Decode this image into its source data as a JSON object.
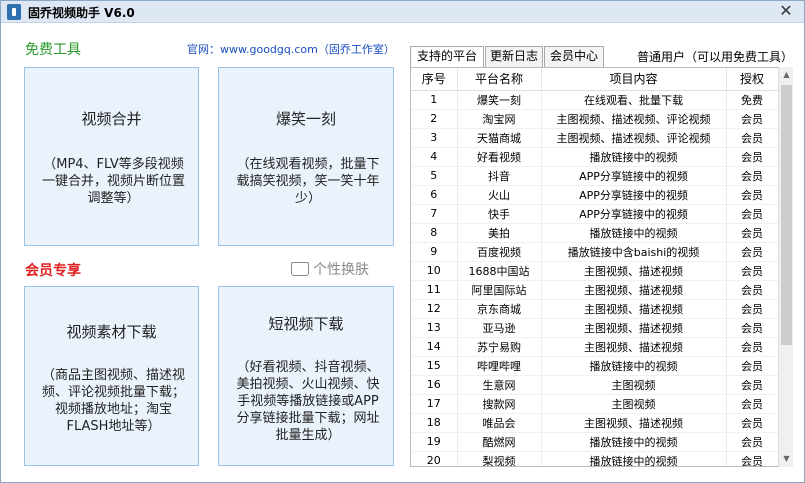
{
  "window": {
    "title": "固乔视频助手 V6.0",
    "close_glyph": "✕"
  },
  "free_section": {
    "label": "免费工具",
    "official_site": "官网：www.goodgq.com（固乔工作室）"
  },
  "member_section": {
    "label": "会员专享",
    "skin_label": "个性换肤"
  },
  "cards": [
    {
      "title": "视频合并",
      "desc": "（MP4、FLV等多段视频一键合并，视频片断位置调整等）"
    },
    {
      "title": "爆笑一刻",
      "desc": "（在线观看视频，批量下载搞笑视频，笑一笑十年少）"
    },
    {
      "title": "视频素材下载",
      "desc": "（商品主图视频、描述视频、评论视频批量下载；视频播放地址；淘宝FLASH地址等）"
    },
    {
      "title": "短视频下载",
      "desc": "（好看视频、抖音视频、美拍视频、火山视频、快手视频等播放链接或APP分享链接批量下载；网址批量生成）"
    }
  ],
  "tabs": [
    "支持的平台",
    "更新日志",
    "会员中心"
  ],
  "user_type": "普通用户（可以用免费工具）",
  "table": {
    "columns": [
      "序号",
      "平台名称",
      "项目内容",
      "授权"
    ],
    "rows": [
      [
        "1",
        "爆笑一刻",
        "在线观看、批量下载",
        "免费"
      ],
      [
        "2",
        "淘宝网",
        "主图视频、描述视频、评论视频",
        "会员"
      ],
      [
        "3",
        "天猫商城",
        "主图视频、描述视频、评论视频",
        "会员"
      ],
      [
        "4",
        "好看视频",
        "播放链接中的视频",
        "会员"
      ],
      [
        "5",
        "抖音",
        "APP分享链接中的视频",
        "会员"
      ],
      [
        "6",
        "火山",
        "APP分享链接中的视频",
        "会员"
      ],
      [
        "7",
        "快手",
        "APP分享链接中的视频",
        "会员"
      ],
      [
        "8",
        "美拍",
        "播放链接中的视频",
        "会员"
      ],
      [
        "9",
        "百度视频",
        "播放链接中含baishi的视频",
        "会员"
      ],
      [
        "10",
        "1688中国站",
        "主图视频、描述视频",
        "会员"
      ],
      [
        "11",
        "阿里国际站",
        "主图视频、描述视频",
        "会员"
      ],
      [
        "12",
        "京东商城",
        "主图视频、描述视频",
        "会员"
      ],
      [
        "13",
        "亚马逊",
        "主图视频、描述视频",
        "会员"
      ],
      [
        "14",
        "苏宁易购",
        "主图视频、描述视频",
        "会员"
      ],
      [
        "15",
        "哔哩哔哩",
        "播放链接中的视频",
        "会员"
      ],
      [
        "16",
        "生意网",
        "主图视频",
        "会员"
      ],
      [
        "17",
        "搜款网",
        "主图视频",
        "会员"
      ],
      [
        "18",
        "唯品会",
        "主图视频、描述视频",
        "会员"
      ],
      [
        "19",
        "酷燃网",
        "播放链接中的视频",
        "会员"
      ],
      [
        "20",
        "梨视频",
        "播放链接中的视频",
        "会员"
      ]
    ]
  }
}
